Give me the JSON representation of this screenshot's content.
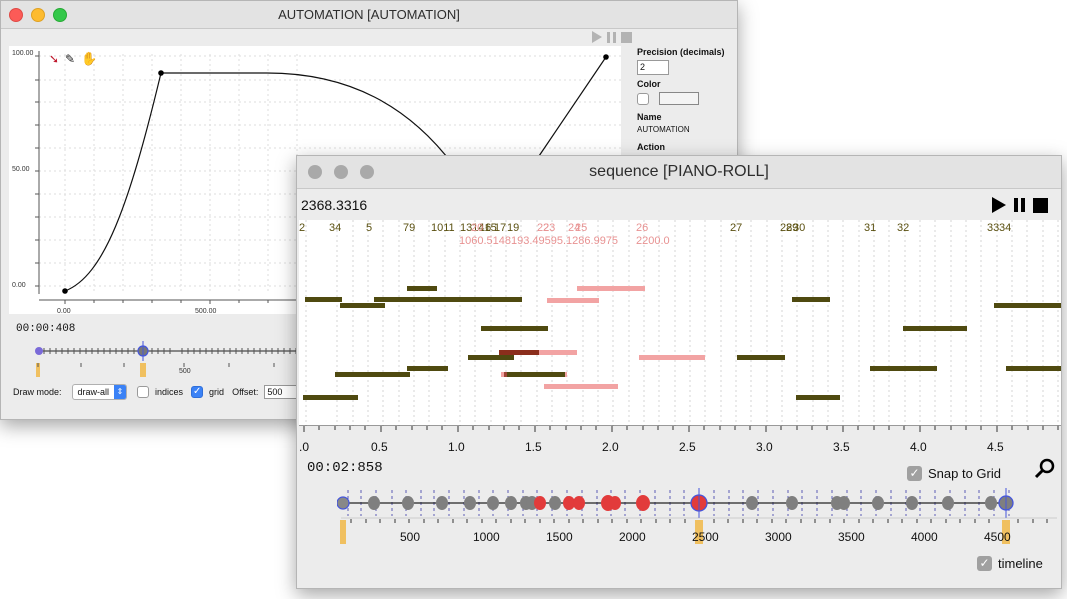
{
  "automation": {
    "title": "AUTOMATION [AUTOMATION]",
    "y_labels": [
      "100.00",
      "50.00",
      "0.00"
    ],
    "x_ticks": [
      "0.00",
      "500.00"
    ],
    "time": "00:00:408",
    "timeline_tick": "500",
    "side": {
      "precision_label": "Precision (decimals)",
      "precision_value": "2",
      "color_label": "Color",
      "name_label": "Name",
      "name_value": "AUTOMATION",
      "action_label": "Action"
    },
    "bottom": {
      "draw_mode_label": "Draw mode:",
      "draw_mode_value": "draw-all",
      "indices_label": "indices",
      "grid_label": "grid",
      "offset_label": "Offset:",
      "offset_value": "500"
    }
  },
  "piano": {
    "title": "sequence [PIANO-ROLL]",
    "position": "2368.3316",
    "time": "00:02:858",
    "snap_label": "Snap to Grid",
    "timeline_label": "timeline",
    "x_ticks": [
      ".0",
      "0.5",
      "1.0",
      "1.5",
      "2.0",
      "2.5",
      "3.0",
      "3.5",
      "4.0",
      "4.5"
    ],
    "timeline_ticks": [
      "500",
      "1000",
      "1500",
      "2000",
      "2500",
      "3000",
      "3500",
      "4000",
      "4500"
    ],
    "index_labels_dark": [
      "2",
      "34",
      "5",
      "79",
      "1011",
      "131415",
      "16",
      "17",
      "19",
      "27",
      "28",
      "29",
      "30",
      "31",
      "32",
      "33",
      "34"
    ],
    "index_labels_pink": [
      "20",
      "22",
      "23",
      "24",
      "25",
      "26"
    ],
    "pink_values": "1060.5148193.49595.1286.9975",
    "pink_value_end": "2200.0"
  },
  "colors": {
    "note_dark": "#4f4a10",
    "note_pink": "#f2a3a3",
    "note_red": "#8b2e1c",
    "marker_red": "#e23b3b",
    "marker_gray": "#7f7f7f",
    "handle_gold": "#f0c060",
    "check_blue": "#3b82f6"
  }
}
